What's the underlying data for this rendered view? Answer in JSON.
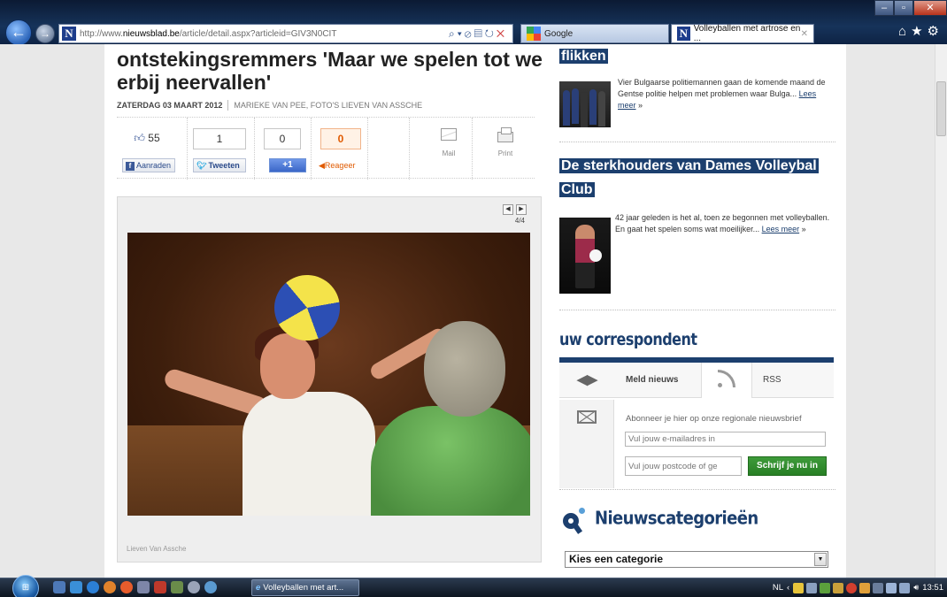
{
  "browser": {
    "url_prefix": "http://www.",
    "url_domain": "nieuwsblad.be",
    "url_path": "/article/detail.aspx?articleid=GIV3N0CIT",
    "favicon_letter": "N",
    "tabs": [
      {
        "label": "Google"
      },
      {
        "label": "Volleyballen met artrose en ..."
      }
    ]
  },
  "article": {
    "headline": "ontstekingsremmers 'Maar we spelen tot we erbij neervallen'",
    "date": "ZATERDAG 03 MAART 2012",
    "author": "MARIEKE VAN PEE, FOTO'S LIEVEN VAN ASSCHE",
    "share": {
      "like_count": "55",
      "like_button": "Aanraden",
      "tweet_count": "1",
      "tweet_button": "Tweeten",
      "plusone_count": "0",
      "plusone_button": "+1",
      "react_count": "0",
      "react_button": "Reageer",
      "mail_label": "Mail",
      "print_label": "Print"
    },
    "photo": {
      "counter": "4/4",
      "credit": "Lieven Van Assche"
    }
  },
  "sidebar": {
    "story1": {
      "title": "flikken",
      "text": "Vier Bulgaarse politiemannen gaan de komende maand de Gentse politie helpen met problemen waar Bulga...",
      "more": "Lees meer",
      "more_suffix": "»"
    },
    "story2": {
      "title": "De sterkhouders van Dames Volleybal Club",
      "text": "42 jaar geleden is het al, toen ze begonnen met volleyballen. En gaat het spelen soms wat moeilijker...",
      "more": "Lees meer",
      "more_suffix": "»"
    },
    "correspondent": {
      "title": "uw correspondent",
      "meld": "Meld nieuws",
      "rss": "RSS",
      "newsletter_text": "Abonneer je hier op onze regionale nieuwsbrief",
      "email_placeholder": "Vul jouw e-mailadres in",
      "postcode_placeholder": "Vul jouw postcode of ge",
      "submit": "Schrijf je nu in"
    },
    "categories": {
      "title": "Nieuwscategorieën",
      "select_value": "Kies een categorie"
    }
  },
  "taskbar": {
    "task_label": "Volleyballen met art...",
    "language": "NL",
    "time": "13:51"
  },
  "colors": {
    "brand_navy": "#1c3f6e",
    "submit_green": "#2f8c2b",
    "react_orange": "#e05a00"
  }
}
